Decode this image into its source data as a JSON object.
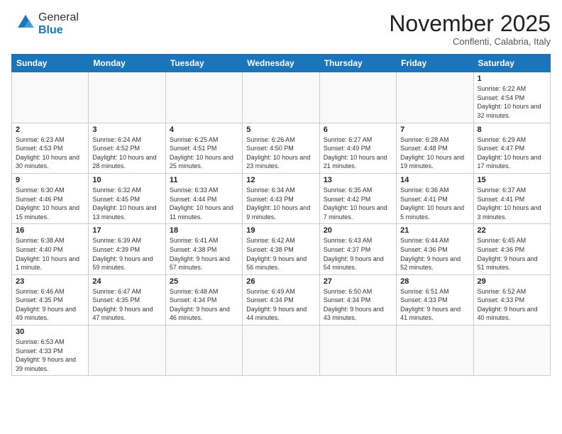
{
  "logo": {
    "text_general": "General",
    "text_blue": "Blue"
  },
  "title": "November 2025",
  "subtitle": "Conflenti, Calabria, Italy",
  "days_of_week": [
    "Sunday",
    "Monday",
    "Tuesday",
    "Wednesday",
    "Thursday",
    "Friday",
    "Saturday"
  ],
  "weeks": [
    [
      {
        "day": "",
        "info": ""
      },
      {
        "day": "",
        "info": ""
      },
      {
        "day": "",
        "info": ""
      },
      {
        "day": "",
        "info": ""
      },
      {
        "day": "",
        "info": ""
      },
      {
        "day": "",
        "info": ""
      },
      {
        "day": "1",
        "info": "Sunrise: 6:22 AM\nSunset: 4:54 PM\nDaylight: 10 hours and 32 minutes."
      }
    ],
    [
      {
        "day": "2",
        "info": "Sunrise: 6:23 AM\nSunset: 4:53 PM\nDaylight: 10 hours and 30 minutes."
      },
      {
        "day": "3",
        "info": "Sunrise: 6:24 AM\nSunset: 4:52 PM\nDaylight: 10 hours and 28 minutes."
      },
      {
        "day": "4",
        "info": "Sunrise: 6:25 AM\nSunset: 4:51 PM\nDaylight: 10 hours and 25 minutes."
      },
      {
        "day": "5",
        "info": "Sunrise: 6:26 AM\nSunset: 4:50 PM\nDaylight: 10 hours and 23 minutes."
      },
      {
        "day": "6",
        "info": "Sunrise: 6:27 AM\nSunset: 4:49 PM\nDaylight: 10 hours and 21 minutes."
      },
      {
        "day": "7",
        "info": "Sunrise: 6:28 AM\nSunset: 4:48 PM\nDaylight: 10 hours and 19 minutes."
      },
      {
        "day": "8",
        "info": "Sunrise: 6:29 AM\nSunset: 4:47 PM\nDaylight: 10 hours and 17 minutes."
      }
    ],
    [
      {
        "day": "9",
        "info": "Sunrise: 6:30 AM\nSunset: 4:46 PM\nDaylight: 10 hours and 15 minutes."
      },
      {
        "day": "10",
        "info": "Sunrise: 6:32 AM\nSunset: 4:45 PM\nDaylight: 10 hours and 13 minutes."
      },
      {
        "day": "11",
        "info": "Sunrise: 6:33 AM\nSunset: 4:44 PM\nDaylight: 10 hours and 11 minutes."
      },
      {
        "day": "12",
        "info": "Sunrise: 6:34 AM\nSunset: 4:43 PM\nDaylight: 10 hours and 9 minutes."
      },
      {
        "day": "13",
        "info": "Sunrise: 6:35 AM\nSunset: 4:42 PM\nDaylight: 10 hours and 7 minutes."
      },
      {
        "day": "14",
        "info": "Sunrise: 6:36 AM\nSunset: 4:41 PM\nDaylight: 10 hours and 5 minutes."
      },
      {
        "day": "15",
        "info": "Sunrise: 6:37 AM\nSunset: 4:41 PM\nDaylight: 10 hours and 3 minutes."
      }
    ],
    [
      {
        "day": "16",
        "info": "Sunrise: 6:38 AM\nSunset: 4:40 PM\nDaylight: 10 hours and 1 minute."
      },
      {
        "day": "17",
        "info": "Sunrise: 6:39 AM\nSunset: 4:39 PM\nDaylight: 9 hours and 59 minutes."
      },
      {
        "day": "18",
        "info": "Sunrise: 6:41 AM\nSunset: 4:38 PM\nDaylight: 9 hours and 57 minutes."
      },
      {
        "day": "19",
        "info": "Sunrise: 6:42 AM\nSunset: 4:38 PM\nDaylight: 9 hours and 56 minutes."
      },
      {
        "day": "20",
        "info": "Sunrise: 6:43 AM\nSunset: 4:37 PM\nDaylight: 9 hours and 54 minutes."
      },
      {
        "day": "21",
        "info": "Sunrise: 6:44 AM\nSunset: 4:36 PM\nDaylight: 9 hours and 52 minutes."
      },
      {
        "day": "22",
        "info": "Sunrise: 6:45 AM\nSunset: 4:36 PM\nDaylight: 9 hours and 51 minutes."
      }
    ],
    [
      {
        "day": "23",
        "info": "Sunrise: 6:46 AM\nSunset: 4:35 PM\nDaylight: 9 hours and 49 minutes."
      },
      {
        "day": "24",
        "info": "Sunrise: 6:47 AM\nSunset: 4:35 PM\nDaylight: 9 hours and 47 minutes."
      },
      {
        "day": "25",
        "info": "Sunrise: 6:48 AM\nSunset: 4:34 PM\nDaylight: 9 hours and 46 minutes."
      },
      {
        "day": "26",
        "info": "Sunrise: 6:49 AM\nSunset: 4:34 PM\nDaylight: 9 hours and 44 minutes."
      },
      {
        "day": "27",
        "info": "Sunrise: 6:50 AM\nSunset: 4:34 PM\nDaylight: 9 hours and 43 minutes."
      },
      {
        "day": "28",
        "info": "Sunrise: 6:51 AM\nSunset: 4:33 PM\nDaylight: 9 hours and 41 minutes."
      },
      {
        "day": "29",
        "info": "Sunrise: 6:52 AM\nSunset: 4:33 PM\nDaylight: 9 hours and 40 minutes."
      }
    ],
    [
      {
        "day": "30",
        "info": "Sunrise: 6:53 AM\nSunset: 4:33 PM\nDaylight: 9 hours and 39 minutes."
      },
      {
        "day": "",
        "info": ""
      },
      {
        "day": "",
        "info": ""
      },
      {
        "day": "",
        "info": ""
      },
      {
        "day": "",
        "info": ""
      },
      {
        "day": "",
        "info": ""
      },
      {
        "day": "",
        "info": ""
      }
    ]
  ]
}
